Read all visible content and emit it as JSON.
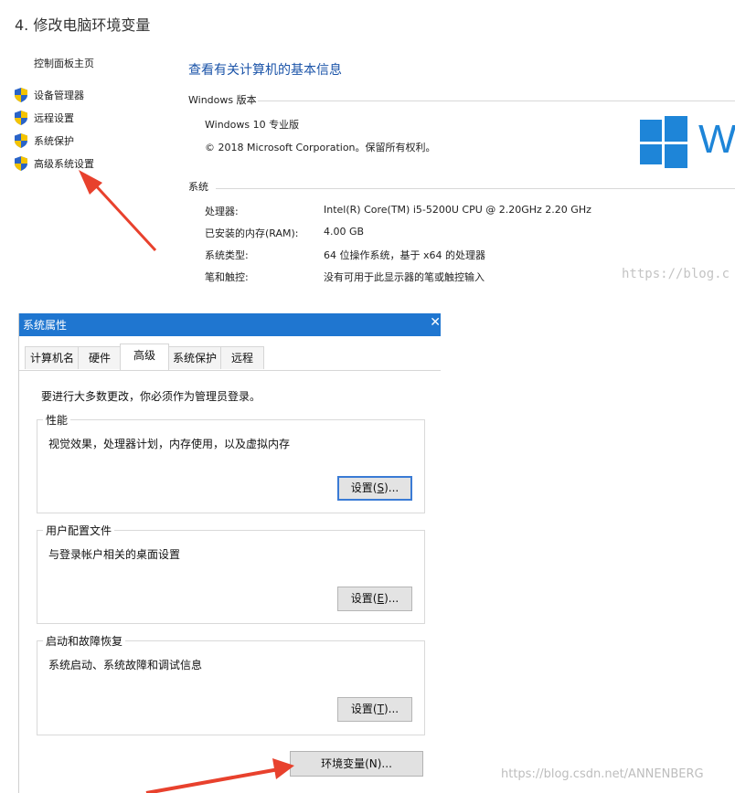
{
  "heading": "4. 修改电脑环境变量",
  "nav": {
    "home": "控制面板主页",
    "items": [
      {
        "label": "设备管理器",
        "icon": "shield-icon"
      },
      {
        "label": "远程设置",
        "icon": "shield-icon"
      },
      {
        "label": "系统保护",
        "icon": "shield-icon"
      },
      {
        "label": "高级系统设置",
        "icon": "shield-icon"
      }
    ]
  },
  "system": {
    "title": "查看有关计算机的基本信息",
    "edition_header": "Windows 版本",
    "edition_name": "Windows 10 专业版",
    "copyright": "© 2018 Microsoft Corporation。保留所有权利。",
    "system_header": "系统",
    "rows": [
      {
        "label": "处理器:",
        "value": "Intel(R) Core(TM) i5-5200U CPU @ 2.20GHz   2.20 GHz"
      },
      {
        "label": "已安装的内存(RAM):",
        "value": "4.00 GB"
      },
      {
        "label": "系统类型:",
        "value": "64 位操作系统，基于 x64 的处理器"
      },
      {
        "label": "笔和触控:",
        "value": "没有可用于此显示器的笔或触控输入"
      }
    ],
    "logo_text": "W"
  },
  "watermark_top": "https://blog.c",
  "dialog": {
    "title": "系统属性",
    "close": "✕",
    "tabs": [
      "计算机名",
      "硬件",
      "高级",
      "系统保护",
      "远程"
    ],
    "active_tab": "高级",
    "admin_note": "要进行大多数更改，你必须作为管理员登录。",
    "groups": [
      {
        "title": "性能",
        "desc": "视觉效果，处理器计划，内存使用，以及虚拟内存",
        "button_pre": "设置(",
        "button_key": "S",
        "button_post": ")..."
      },
      {
        "title": "用户配置文件",
        "desc": "与登录帐户相关的桌面设置",
        "button_pre": "设置(",
        "button_key": "E",
        "button_post": ")..."
      },
      {
        "title": "启动和故障恢复",
        "desc": "系统启动、系统故障和调试信息",
        "button_pre": "设置(",
        "button_key": "T",
        "button_post": ")..."
      }
    ],
    "env_button": "环境变量(N)..."
  },
  "credit": "https://blog.csdn.net/ANNENBERG",
  "colors": {
    "accent": "#1f76d0",
    "link": "#1a53a8",
    "arrow": "#e8412d",
    "logo": "#1e85d8"
  }
}
